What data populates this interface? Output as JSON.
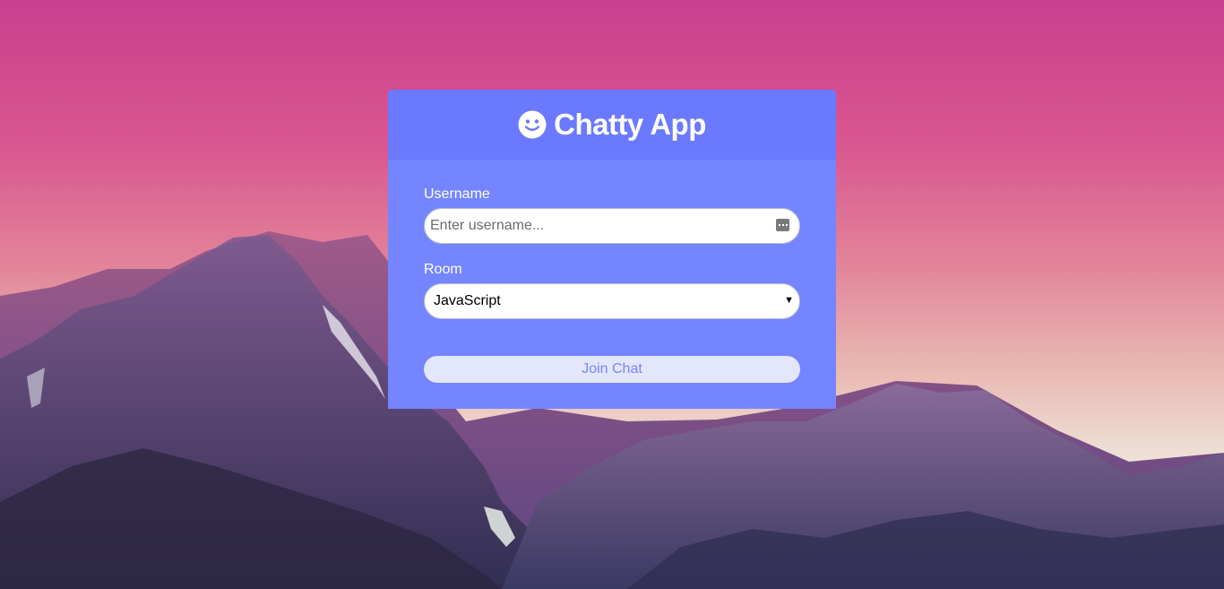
{
  "app": {
    "title": "Chatty App",
    "logo_icon": "smile-icon"
  },
  "form": {
    "username_label": "Username",
    "username_placeholder": "Enter username...",
    "username_value": "",
    "room_label": "Room",
    "room_selected": "JavaScript",
    "join_label": "Join Chat"
  },
  "colors": {
    "card": "#7585ff",
    "header": "#6b79fe",
    "button_bg": "#e4e6fb",
    "button_text": "#7585ff"
  }
}
